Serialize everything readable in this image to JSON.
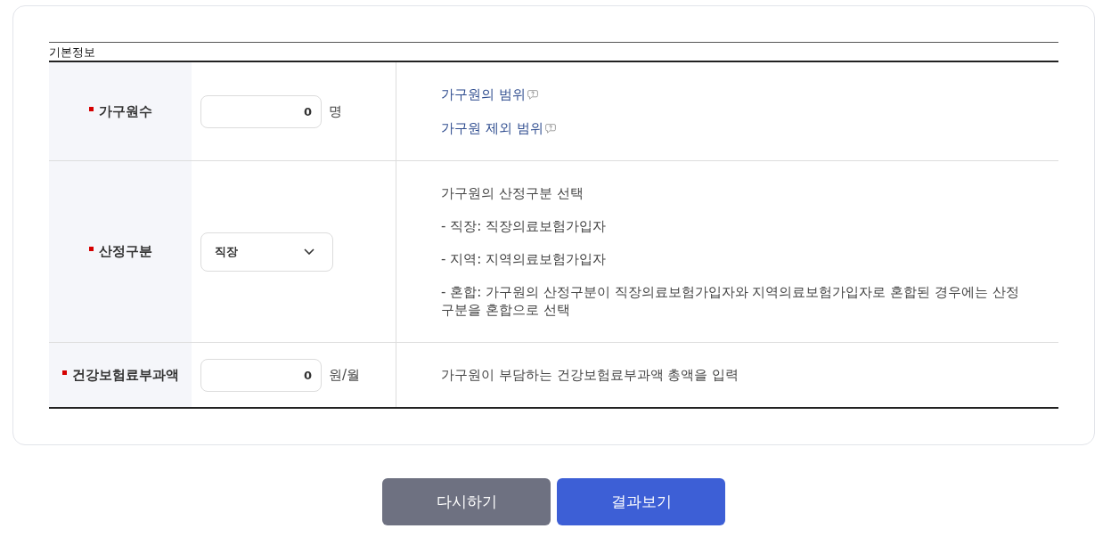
{
  "section": {
    "title": "기본정보"
  },
  "rows": [
    {
      "label": "가구원수",
      "required": true,
      "field": {
        "kind": "number",
        "value": "0",
        "unit": "명"
      },
      "description": [
        {
          "kind": "link",
          "text": "가구원의 범위"
        },
        {
          "kind": "link",
          "text": "가구원 제외 범위"
        }
      ]
    },
    {
      "label": "산정구분",
      "required": true,
      "field": {
        "kind": "select",
        "value": "직장"
      },
      "description": [
        {
          "kind": "text",
          "text": "가구원의 산정구분 선택"
        },
        {
          "kind": "text",
          "text": "- 직장: 직장의료보험가입자"
        },
        {
          "kind": "text",
          "text": "- 지역: 지역의료보험가입자"
        },
        {
          "kind": "text",
          "text": "- 혼합: 가구원의 산정구분이 직장의료보험가입자와 지역의료보험가입자로 혼합된 경우에는 산정구분을 혼합으로 선택"
        }
      ]
    },
    {
      "label": "건강보험료부과액",
      "required": true,
      "field": {
        "kind": "number",
        "value": "0",
        "unit": "원/월"
      },
      "description": [
        {
          "kind": "text",
          "text": "가구원이 부담하는 건강보험료부과액 총액을 입력"
        }
      ]
    }
  ],
  "buttons": [
    {
      "label": "다시하기",
      "kind": "secondary"
    },
    {
      "label": "결과보기",
      "kind": "primary"
    }
  ]
}
